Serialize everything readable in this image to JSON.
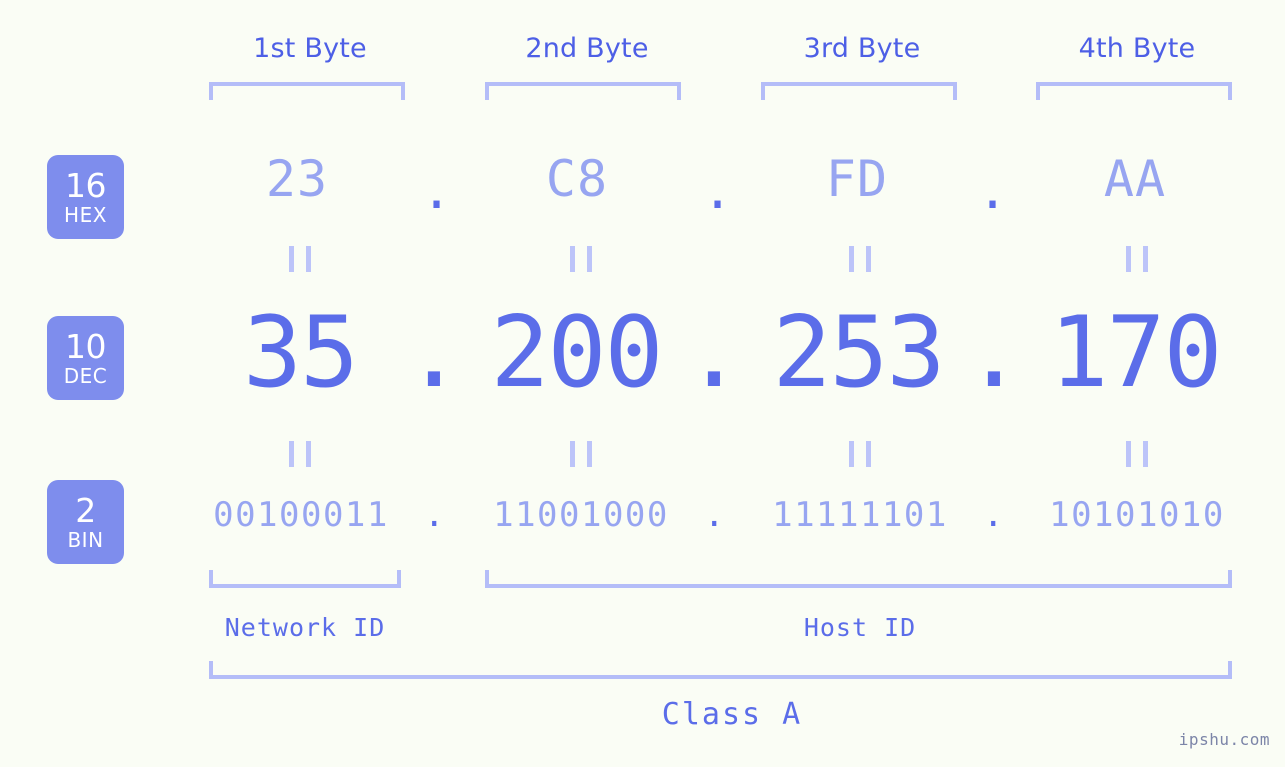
{
  "page": {
    "background_color": "#fafdf5",
    "accent_color": "#5b6de9",
    "badge_color": "#7e8ded",
    "light_accent_color": "#97a5f1",
    "bracket_color": "#b4bdf8",
    "watermark": "ipshu.com"
  },
  "byte_headers": [
    {
      "label": "1st Byte"
    },
    {
      "label": "2nd Byte"
    },
    {
      "label": "3rd Byte"
    },
    {
      "label": "4th Byte"
    }
  ],
  "rows": {
    "hex": {
      "badge_num": "16",
      "badge_word": "HEX",
      "values": [
        "23",
        "C8",
        "FD",
        "AA"
      ],
      "separator": "."
    },
    "dec": {
      "badge_num": "10",
      "badge_word": "DEC",
      "values": [
        "35",
        "200",
        "253",
        "170"
      ],
      "separator": "."
    },
    "bin": {
      "badge_num": "2",
      "badge_word": "BIN",
      "values": [
        "00100011",
        "11001000",
        "11111101",
        "10101010"
      ],
      "separator": "."
    }
  },
  "equality_marks": {
    "hex_to_dec_count": 4,
    "dec_to_bin_count": 4,
    "glyph": "="
  },
  "id_sections": [
    {
      "label": "Network ID"
    },
    {
      "label": "Host ID"
    }
  ],
  "class_section": {
    "label": "Class A"
  }
}
